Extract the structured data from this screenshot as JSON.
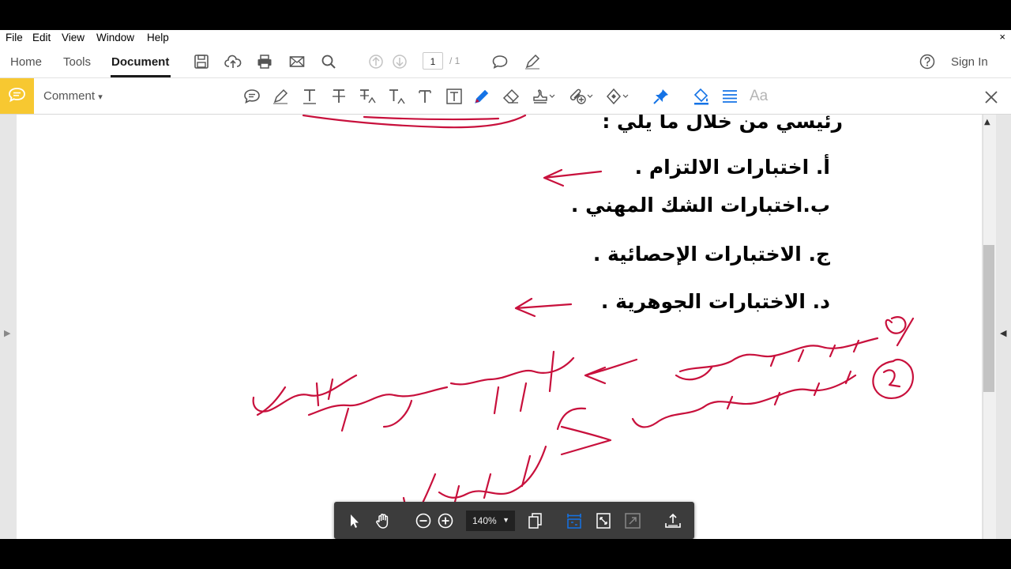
{
  "menu": [
    "File",
    "Edit",
    "View",
    "Window",
    "Help"
  ],
  "menu_close": "×",
  "toolbar": {
    "tabs": [
      "Home",
      "Tools",
      "Document"
    ],
    "active_tab": "Document",
    "page_current": "1",
    "page_total": "/ 1",
    "sign_in": "Sign In"
  },
  "commentbar": {
    "label": "Comment",
    "caret": "▾",
    "close": "×"
  },
  "document": {
    "lines": [
      "رئيسي من خلال ما يلي :",
      "أ.  اختبارات الالتزام .",
      "ب.اختبارات الشك المهني .",
      "ج. الاختبارات الإحصائية .",
      "د. الاختبارات الجوهرية ."
    ]
  },
  "floating": {
    "zoom": "140%"
  },
  "colors": {
    "accent": "#f7c831",
    "ink": "#c8103c",
    "pin": "#1473e6"
  },
  "icons": {
    "toolbar": [
      "save-icon",
      "cloud-upload-icon",
      "print-icon",
      "mail-icon",
      "search-icon",
      "prev-page-icon",
      "next-page-icon",
      "comment-icon",
      "pen-icon",
      "help-icon"
    ],
    "comment_tools": [
      "sticky-note-icon",
      "highlight-icon",
      "text-icon",
      "strikethrough-icon",
      "replace-text-icon",
      "insert-text-icon",
      "add-text-icon",
      "text-box-icon",
      "draw-pencil-icon",
      "eraser-icon",
      "stamp-icon",
      "attach-icon",
      "shapes-icon",
      "pin-icon",
      "fill-icon",
      "lines-icon",
      "font-icon"
    ]
  }
}
